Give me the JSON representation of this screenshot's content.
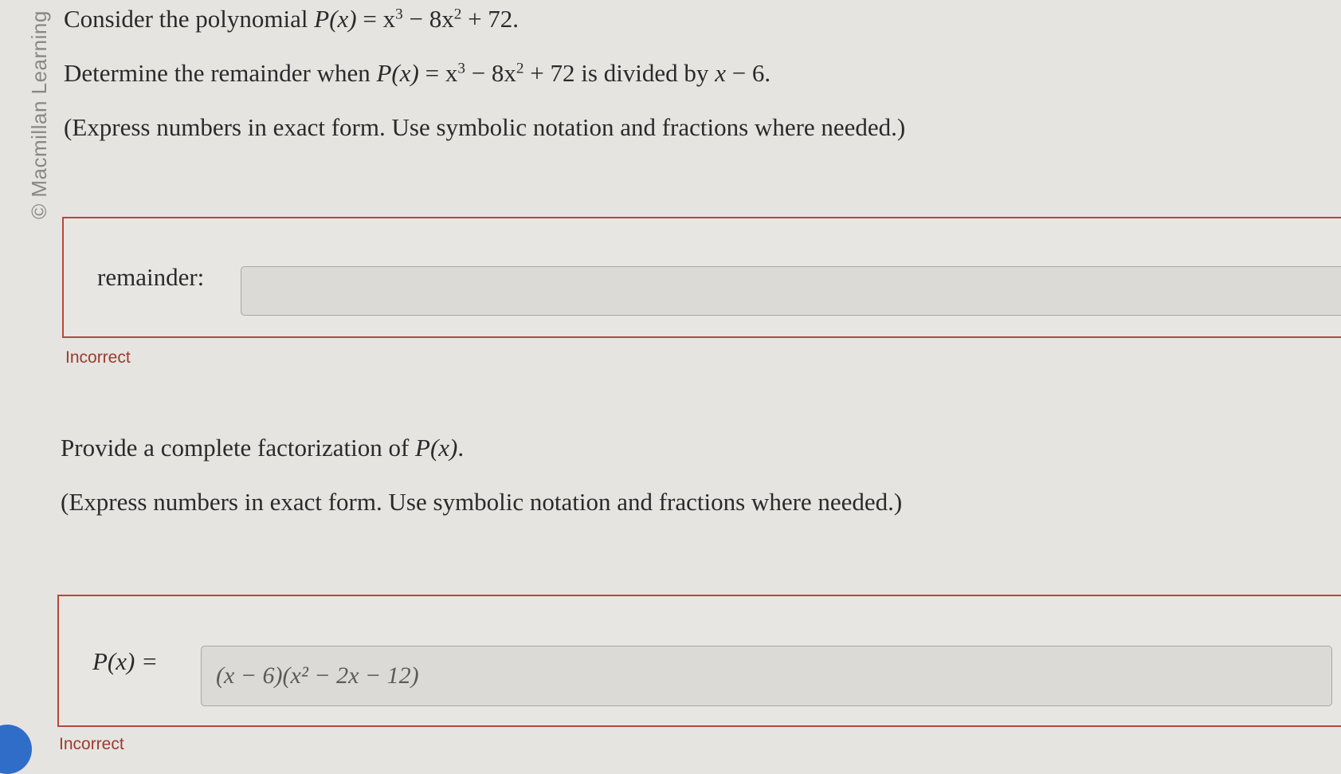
{
  "sidebar": {
    "copyright": "© Macmillan Learning"
  },
  "question": {
    "intro_prefix": "Consider the polynomial ",
    "intro_expr_head": "P(x)",
    "intro_expr_eq": " = x",
    "exp3": "3",
    "intro_mid": " − 8x",
    "exp2": "2",
    "intro_tail": " + 72.",
    "part1_prefix": "Determine the remainder when ",
    "part1_expr_head": "P(x)",
    "part1_eq": " = x",
    "part1_mid": " − 8x",
    "part1_tail": " + 72 is divided by ",
    "part1_divisor": "x",
    "part1_divisor_tail": " − 6.",
    "instruction": "(Express numbers in exact form. Use symbolic notation and fractions where needed.)"
  },
  "answer1": {
    "label": "remainder:",
    "value": "",
    "status": "Incorrect"
  },
  "part2": {
    "prompt_prefix": "Provide a complete factorization of ",
    "prompt_expr": "P(x)",
    "prompt_tail": ".",
    "instruction": "(Express numbers in exact form. Use symbolic notation and fractions where needed.)"
  },
  "answer2": {
    "label": "P(x) =",
    "value": "(x − 6)(x² − 2x − 12)",
    "status": "Incorrect"
  },
  "colors": {
    "error": "#b04a3a",
    "accent": "#2f6dc8"
  }
}
